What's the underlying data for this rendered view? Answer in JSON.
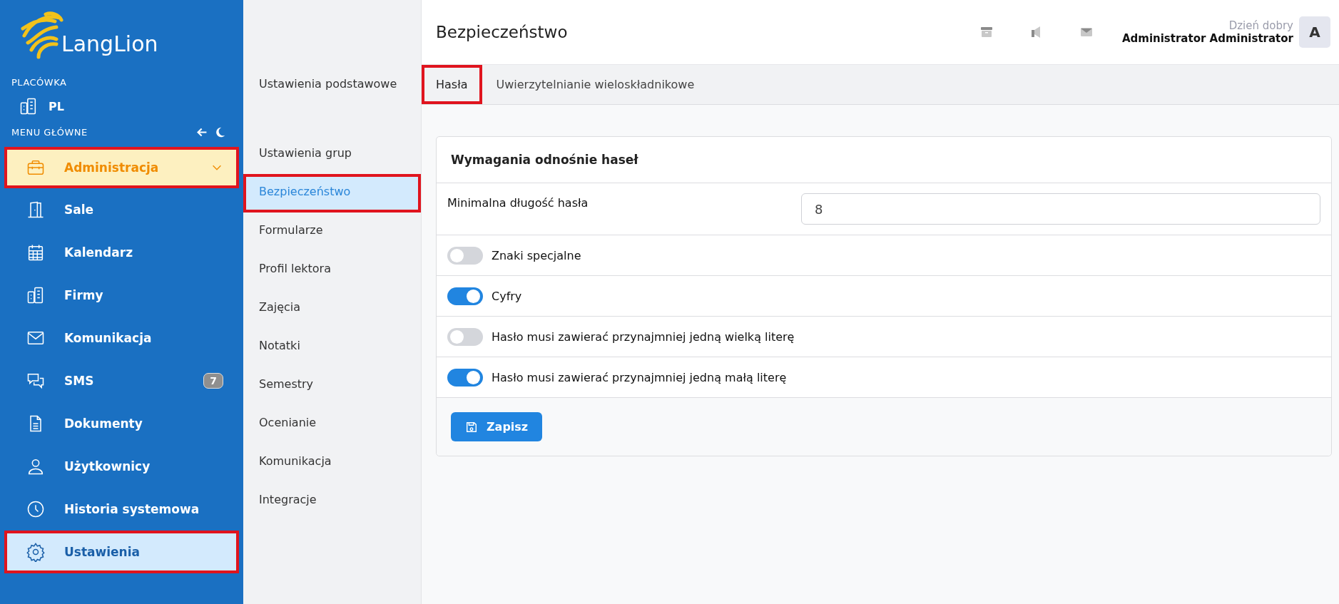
{
  "sidebar": {
    "logo": "LangLion",
    "branch_heading": "PLACÓWKA",
    "branch": "PL",
    "menu_heading": "MENU GŁÓWNE",
    "items": [
      {
        "label": "Administracja",
        "kind": "group",
        "expanded": true,
        "selected": false,
        "highlighted": true
      },
      {
        "label": "Sale",
        "kind": "link",
        "selected": false,
        "highlighted": false
      },
      {
        "label": "Kalendarz",
        "kind": "link",
        "selected": false,
        "highlighted": false
      },
      {
        "label": "Firmy",
        "kind": "link",
        "selected": false,
        "highlighted": false
      },
      {
        "label": "Komunikacja",
        "kind": "link",
        "selected": false,
        "highlighted": false
      },
      {
        "label": "SMS",
        "kind": "link",
        "selected": false,
        "highlighted": false,
        "badge": "7"
      },
      {
        "label": "Dokumenty",
        "kind": "link",
        "selected": false,
        "highlighted": false
      },
      {
        "label": "Użytkownicy",
        "kind": "link",
        "selected": false,
        "highlighted": false
      },
      {
        "label": "Historia systemowa",
        "kind": "link",
        "selected": false,
        "highlighted": false
      },
      {
        "label": "Ustawienia",
        "kind": "link",
        "selected": true,
        "highlighted": true
      }
    ]
  },
  "submenu": [
    {
      "label": "Ustawienia podstawowe",
      "selected": false,
      "highlighted": false
    },
    {
      "label": "Ustawienia grup",
      "selected": false,
      "highlighted": false
    },
    {
      "label": "Bezpieczeństwo",
      "selected": true,
      "highlighted": true
    },
    {
      "label": "Formularze",
      "selected": false,
      "highlighted": false
    },
    {
      "label": "Profil lektora",
      "selected": false,
      "highlighted": false
    },
    {
      "label": "Zajęcia",
      "selected": false,
      "highlighted": false
    },
    {
      "label": "Notatki",
      "selected": false,
      "highlighted": false
    },
    {
      "label": "Semestry",
      "selected": false,
      "highlighted": false
    },
    {
      "label": "Ocenianie",
      "selected": false,
      "highlighted": false
    },
    {
      "label": "Komunikacja",
      "selected": false,
      "highlighted": false
    },
    {
      "label": "Integracje",
      "selected": false,
      "highlighted": false
    }
  ],
  "header": {
    "title": "Bezpieczeństwo",
    "greeting": "Dzień dobry",
    "user_name": "Administrator Administrator",
    "avatar": "A"
  },
  "tabs": [
    {
      "label": "Hasła",
      "selected": true,
      "highlighted": true
    },
    {
      "label": "Uwierzytelnianie wieloskładnikowe",
      "selected": false,
      "highlighted": false
    }
  ],
  "card": {
    "title": "Wymagania odnośnie haseł",
    "min_length": {
      "label": "Minimalna długość hasła",
      "value": "8"
    },
    "toggles": [
      {
        "label": "Znaki specjalne",
        "on": false
      },
      {
        "label": "Cyfry",
        "on": true
      },
      {
        "label": "Hasło musi zawierać przynajmniej jedną wielką literę",
        "on": false
      },
      {
        "label": "Hasło musi zawierać przynajmniej jedną małą literę",
        "on": true
      }
    ],
    "save_button": "Zapisz"
  }
}
